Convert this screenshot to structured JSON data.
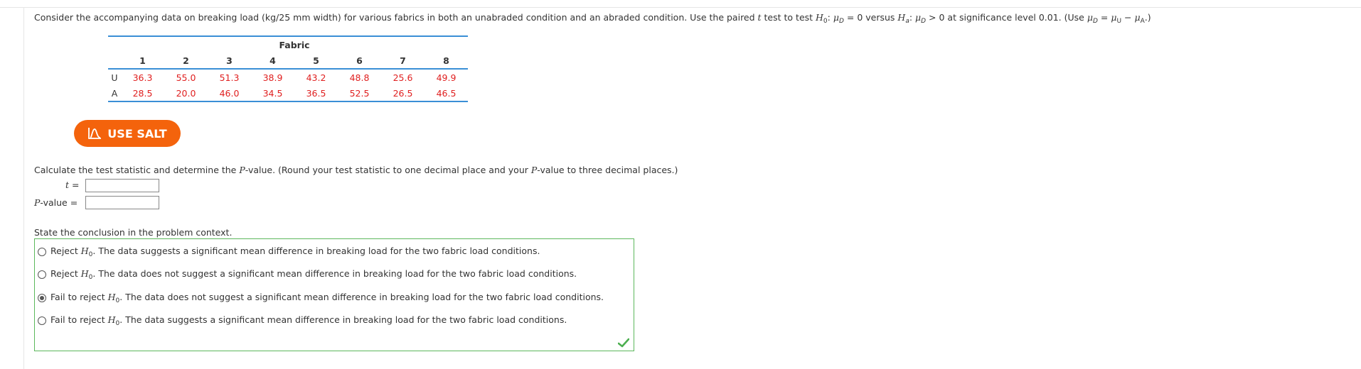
{
  "prompt": {
    "intro": "Consider the accompanying data on breaking load (kg/25 mm width) for various fabrics in both an unabraded condition and an abraded condition. Use the paired ",
    "t": "t",
    "mid1": " test to test ",
    "H": "H",
    "zero": "0",
    "a": "a",
    "mu": "μ",
    "D": "D",
    "U": "U",
    "A": "A",
    "eq0": " = 0 versus ",
    "gt0": " > 0 at significance level 0.01. (Use ",
    "colon": ": ",
    "eq": " = ",
    "minus": " − ",
    "end": ".)"
  },
  "table": {
    "group_header": "Fabric",
    "columns": [
      "1",
      "2",
      "3",
      "4",
      "5",
      "6",
      "7",
      "8"
    ],
    "rows": [
      {
        "label": "U",
        "values": [
          "36.3",
          "55.0",
          "51.3",
          "38.9",
          "43.2",
          "48.8",
          "25.6",
          "49.9"
        ]
      },
      {
        "label": "A",
        "values": [
          "28.5",
          "20.0",
          "46.0",
          "34.5",
          "36.5",
          "52.5",
          "26.5",
          "46.5"
        ]
      }
    ],
    "value_color": "#e02020",
    "rule_color": "#3a8fd6"
  },
  "salt_button": {
    "label": "USE SALT",
    "icon": "salt-chart-icon",
    "color": "#f4630c"
  },
  "calc": {
    "pre": "Calculate the test statistic and determine the ",
    "P": "P",
    "mid": "-value. (Round your test statistic to one decimal place and your ",
    "end": "-value to three decimal places.)",
    "t_label": "t",
    "eq": " =",
    "p_label_suffix": "-value",
    "t_value": "",
    "p_value": ""
  },
  "conclusion": {
    "heading": "State the conclusion in the problem context.",
    "options": [
      {
        "prefix": "Reject ",
        "text": ". The data suggests a significant mean difference in breaking load for the two fabric load conditions.",
        "selected": false
      },
      {
        "prefix": "Reject ",
        "text": ". The data does not suggest a significant mean difference in breaking load for the two fabric load conditions.",
        "selected": false
      },
      {
        "prefix": "Fail to reject ",
        "text": ". The data does not suggest a significant mean difference in breaking load for the two fabric load conditions.",
        "selected": true
      },
      {
        "prefix": "Fail to reject ",
        "text": ". The data suggests a significant mean difference in breaking load for the two fabric load conditions.",
        "selected": false
      }
    ],
    "status": "correct",
    "border_color": "#5cb85c"
  }
}
